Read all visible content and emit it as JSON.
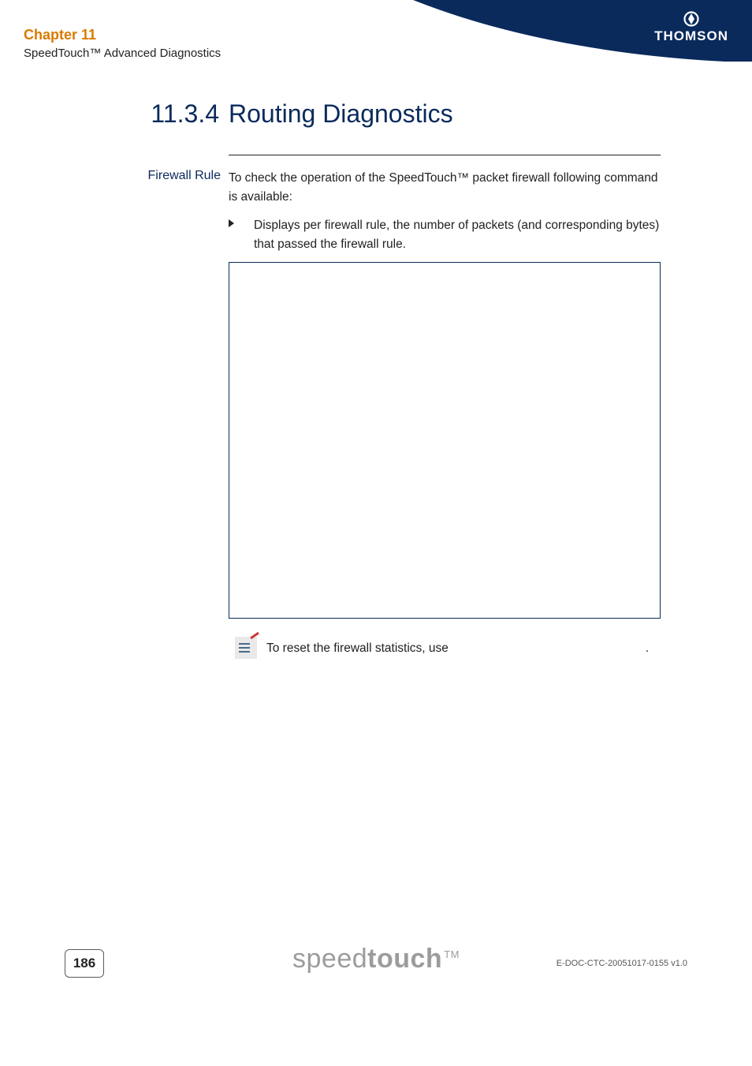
{
  "header": {
    "chapter_title": "Chapter 11",
    "chapter_subtitle": "SpeedTouch™ Advanced Diagnostics",
    "brand": "THOMSON"
  },
  "section": {
    "number": "11.3.4",
    "title": "Routing Diagnostics"
  },
  "left_label": "Firewall Rule",
  "paragraph_intro": "To check the operation of the SpeedTouch™ packet firewall following command is available:",
  "bullet_text": "Displays per firewall rule, the number of packets (and corresponding bytes) that passed the firewall rule.",
  "note_text_prefix": "To reset the firewall statistics, use",
  "note_text_suffix": ".",
  "footer": {
    "page_number": "186",
    "brand_light": "speed",
    "brand_bold": "touch",
    "brand_tm": "TM",
    "doc_id": "E-DOC-CTC-20051017-0155 v1.0"
  }
}
